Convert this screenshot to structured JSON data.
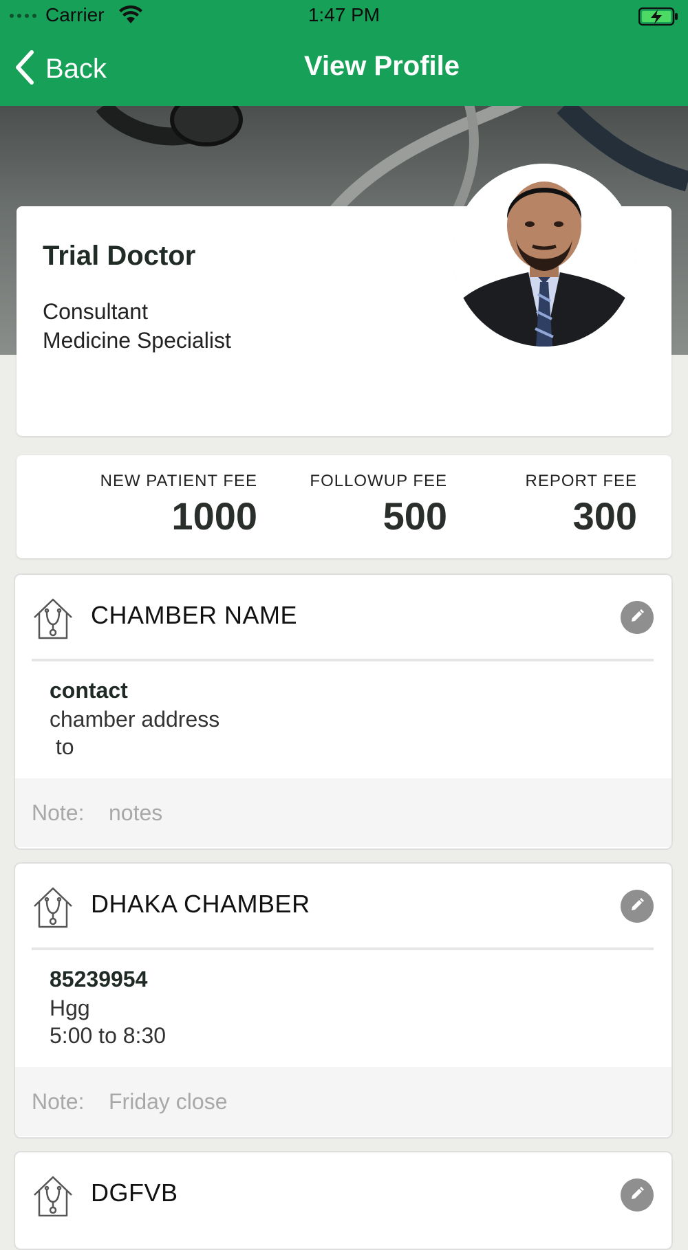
{
  "status_bar": {
    "carrier": "Carrier",
    "time": "1:47 PM"
  },
  "nav": {
    "back_label": "Back",
    "title": "View Profile"
  },
  "profile": {
    "name": "Trial Doctor",
    "designation": "Consultant",
    "specialty": "Medicine Specialist"
  },
  "fees": [
    {
      "label": "NEW PATIENT FEE",
      "value": "1000"
    },
    {
      "label": "FOLLOWUP FEE",
      "value": "500"
    },
    {
      "label": "REPORT FEE",
      "value": "300"
    }
  ],
  "chambers": [
    {
      "name": "CHAMBER NAME",
      "contact": "contact",
      "address": "chamber address",
      "time": " to",
      "note_label": "Note:",
      "note": "notes"
    },
    {
      "name": "DHAKA CHAMBER",
      "contact": "85239954",
      "address": "Hgg",
      "time": "5:00 to 8:30",
      "note_label": "Note:",
      "note": "Friday close"
    },
    {
      "name": "DGFVB"
    }
  ],
  "colors": {
    "header_green": "#17a158",
    "edit_button": "#8f8f8f"
  },
  "icons": [
    "wifi-icon",
    "battery-charging-icon",
    "back-chevron-icon",
    "house-stethoscope-icon",
    "pencil-icon"
  ]
}
